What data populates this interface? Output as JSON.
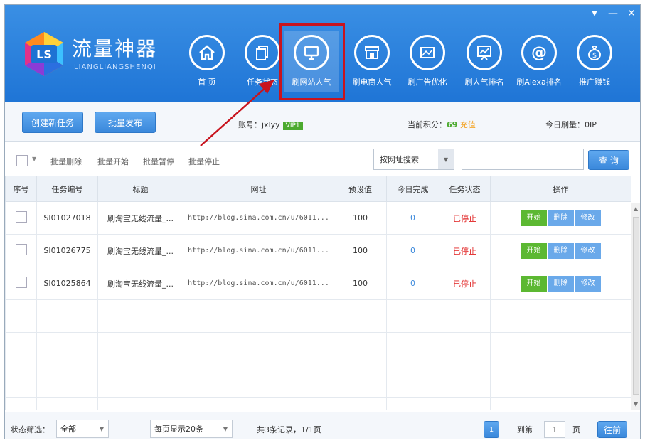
{
  "window": {
    "controls": [
      "▾",
      "—",
      "✕"
    ]
  },
  "brand": {
    "logo_text": "LS",
    "title": "流量神器",
    "subtitle": "LIANGLIANGSHENQI"
  },
  "nav": [
    {
      "label": "首 页",
      "icon": "home-icon"
    },
    {
      "label": "任务状态",
      "icon": "document-icon"
    },
    {
      "label": "刷网站人气",
      "icon": "monitor-icon"
    },
    {
      "label": "刷电商人气",
      "icon": "shop-icon"
    },
    {
      "label": "刷广告优化",
      "icon": "ad-screen-icon"
    },
    {
      "label": "刷人气排名",
      "icon": "chart-icon"
    },
    {
      "label": "刷Alexa排名",
      "icon": "at-icon"
    },
    {
      "label": "推广赚钱",
      "icon": "money-bag-icon"
    }
  ],
  "toolbar1": {
    "create_task": "创建新任务",
    "batch_publish": "批量发布",
    "account_label": "账号：",
    "account_value": "jxlyy",
    "vip_badge": "VIP1",
    "points_label": "当前积分：",
    "points_value": "69",
    "recharge": "充值",
    "today_label": "今日刷量：",
    "today_value": "0IP"
  },
  "toolbar2": {
    "batch_delete": "批量删除",
    "batch_start": "批量开始",
    "batch_pause": "批量暂停",
    "batch_stop": "批量停止",
    "search_mode": "按网址搜索",
    "search_placeholder": "",
    "search_button": "查 询"
  },
  "table": {
    "headers": [
      "序号",
      "任务编号",
      "标题",
      "网址",
      "预设值",
      "今日完成",
      "任务状态",
      "操作"
    ],
    "rows": [
      {
        "id": "SI01027018",
        "title": "刷淘宝无线流量_...",
        "url": "http://blog.sina.com.cn/u/6011...",
        "preset": "100",
        "done": "0",
        "status": "已停止"
      },
      {
        "id": "SI01026775",
        "title": "刷淘宝无线流量_...",
        "url": "http://blog.sina.com.cn/u/6011...",
        "preset": "100",
        "done": "0",
        "status": "已停止"
      },
      {
        "id": "SI01025864",
        "title": "刷淘宝无线流量_...",
        "url": "http://blog.sina.com.cn/u/6011...",
        "preset": "100",
        "done": "0",
        "status": "已停止"
      }
    ],
    "actions": {
      "start": "开始",
      "delete": "删除",
      "edit": "修改"
    }
  },
  "footer": {
    "status_filter_label": "状态筛选：",
    "status_filter_value": "全部",
    "page_size": "每页显示20条",
    "total": "共3条记录，1/1页",
    "current_page": "1",
    "goto_label": "到第",
    "goto_value": "1",
    "page_unit": "页",
    "goto_button": "往前"
  },
  "colors": {
    "header": "#2b82df",
    "highlight": "#c8141e",
    "start": "#5cb832",
    "action": "#6aa9ea",
    "stopped": "#e02020"
  }
}
